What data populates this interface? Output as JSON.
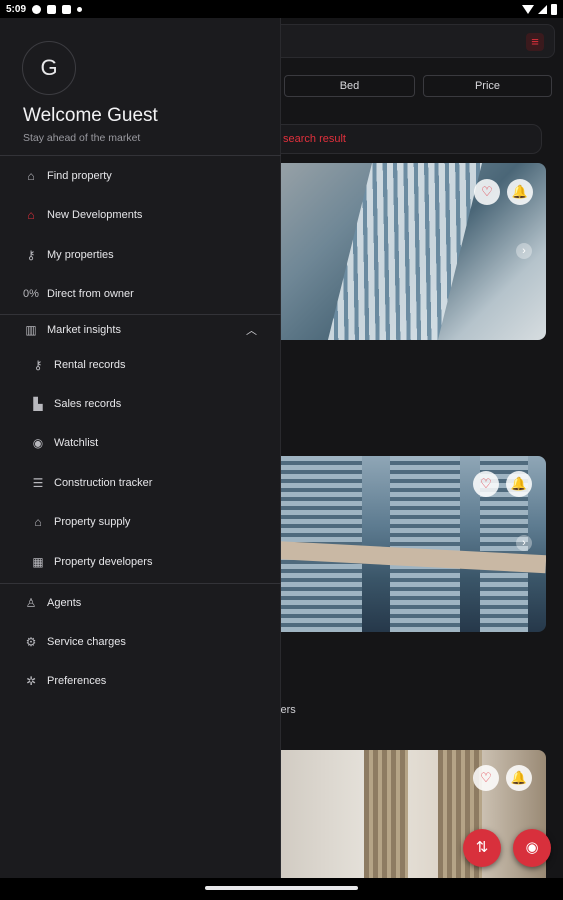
{
  "status_bar": {
    "time": "5:09"
  },
  "background": {
    "filters": [
      "Bed",
      "Price"
    ],
    "search_label": "search result",
    "card_snippet": "vers",
    "colors": {
      "accent": "#e0303c",
      "fab": "#d8303c"
    }
  },
  "drawer": {
    "avatar_initial": "G",
    "welcome": "Welcome Guest",
    "tagline": "Stay ahead of the market",
    "items": [
      {
        "label": "Find property",
        "icon": "home-search-icon"
      },
      {
        "label": "New Developments",
        "icon": "new-home-icon"
      },
      {
        "label": "My properties",
        "icon": "key-icon"
      },
      {
        "label": "Direct from owner",
        "icon": "percent-icon",
        "icon_text": "0%"
      }
    ],
    "market_insights": {
      "label": "Market insights",
      "icon": "chart-icon",
      "expanded": true,
      "subitems": [
        {
          "label": "Rental records",
          "icon": "key-icon"
        },
        {
          "label": "Sales records",
          "icon": "buildings-icon"
        },
        {
          "label": "Watchlist",
          "icon": "eye-icon"
        },
        {
          "label": "Construction tracker",
          "icon": "construction-icon"
        },
        {
          "label": "Property supply",
          "icon": "supply-icon"
        },
        {
          "label": "Property developers",
          "icon": "developer-icon"
        }
      ]
    },
    "bottom_items": [
      {
        "label": "Agents",
        "icon": "person-icon"
      },
      {
        "label": "Service charges",
        "icon": "service-icon"
      },
      {
        "label": "Preferences",
        "icon": "settings-icon"
      }
    ]
  }
}
